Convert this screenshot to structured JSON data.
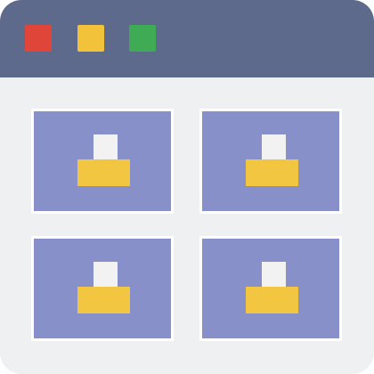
{
  "colors": {
    "titlebar": "#5e6a8c",
    "window_background": "#eef0f2",
    "tile_background": "#8790c8",
    "tile_border": "#ffffff",
    "item_top": "#f2f2f2",
    "item_base": "#f2c640"
  },
  "window_controls": [
    {
      "role": "close",
      "color": "#e0453a"
    },
    {
      "role": "minimize",
      "color": "#f3c23b"
    },
    {
      "role": "maximize",
      "color": "#3fac55"
    }
  ],
  "tiles": [
    {
      "icon": "document-tray-icon"
    },
    {
      "icon": "document-tray-icon"
    },
    {
      "icon": "document-tray-icon"
    },
    {
      "icon": "document-tray-icon"
    }
  ]
}
